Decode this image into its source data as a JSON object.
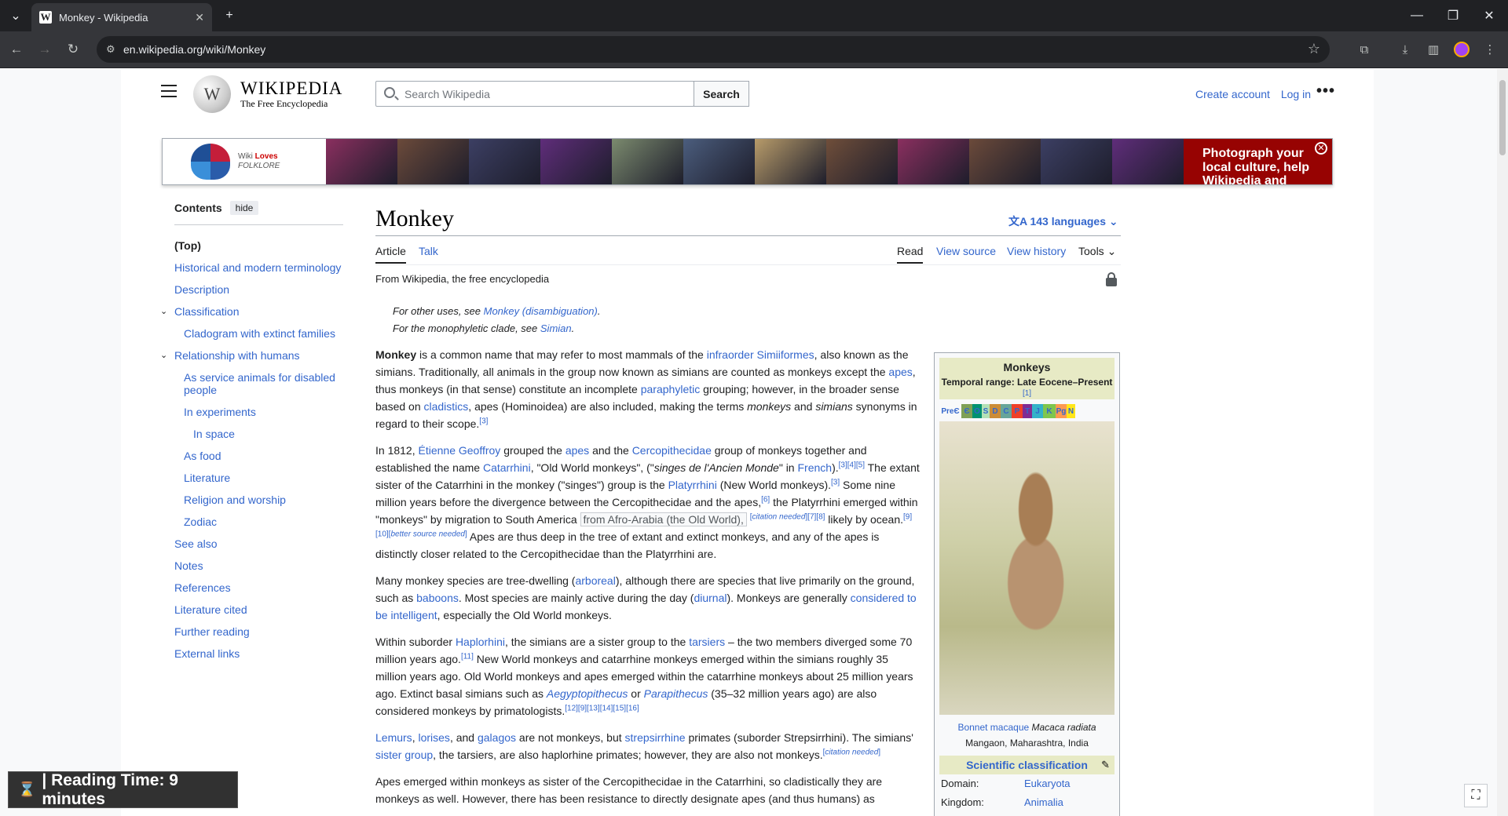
{
  "browser": {
    "tab_title": "Monkey - Wikipedia",
    "tab_favicon": "W",
    "url": "en.wikipedia.org/wiki/Monkey"
  },
  "header": {
    "wordmark": "WIKIPEDIA",
    "tagline": "The Free Encyclopedia",
    "search_placeholder": "Search Wikipedia",
    "search_button": "Search",
    "create_account": "Create account",
    "log_in": "Log in"
  },
  "banner": {
    "logo_line1": "Wiki",
    "logo_line1_b": "Loves",
    "logo_line2": "FOLKLORE",
    "cta": "Photograph your local culture, help Wikipedia and win!",
    "photo_colors": [
      "#8a2f5f",
      "#6b4a3a",
      "#3c3f63",
      "#5f2d7a",
      "#7b8a6e",
      "#4b5d7d",
      "#b79b6a",
      "#6f4e3a",
      "#8a2f5f",
      "#6b4a3a",
      "#3c3f63",
      "#5f2d7a"
    ]
  },
  "toc": {
    "heading": "Contents",
    "hide": "hide",
    "items": [
      {
        "label": "(Top)",
        "level": 1,
        "top": true
      },
      {
        "label": "Historical and modern terminology",
        "level": 1
      },
      {
        "label": "Description",
        "level": 1
      },
      {
        "label": "Classification",
        "level": 1,
        "chevron": true
      },
      {
        "label": "Cladogram with extinct families",
        "level": 2
      },
      {
        "label": "Relationship with humans",
        "level": 1,
        "chevron": true
      },
      {
        "label": "As service animals for disabled people",
        "level": 2,
        "wrap": true
      },
      {
        "label": "In experiments",
        "level": 2
      },
      {
        "label": "In space",
        "level": 3
      },
      {
        "label": "As food",
        "level": 2
      },
      {
        "label": "Literature",
        "level": 2
      },
      {
        "label": "Religion and worship",
        "level": 2
      },
      {
        "label": "Zodiac",
        "level": 2
      },
      {
        "label": "See also",
        "level": 1
      },
      {
        "label": "Notes",
        "level": 1
      },
      {
        "label": "References",
        "level": 1
      },
      {
        "label": "Literature cited",
        "level": 1
      },
      {
        "label": "Further reading",
        "level": 1
      },
      {
        "label": "External links",
        "level": 1
      }
    ]
  },
  "article": {
    "title": "Monkey",
    "languages": "143 languages",
    "tab_article": "Article",
    "tab_talk": "Talk",
    "tab_read": "Read",
    "tab_view_source": "View source",
    "tab_view_history": "View history",
    "tab_tools": "Tools",
    "subtitle": "From Wikipedia, the free encyclopedia",
    "hatnote1_pre": "For other uses, see ",
    "hatnote1_link": "Monkey (disambiguation)",
    "hatnote2_pre": "For the monophyletic clade, see ",
    "hatnote2_link": "Simian"
  },
  "infobox": {
    "name": "Monkeys",
    "range": "Temporal range: Late Eocene–Present",
    "range_ref": "[1]",
    "timeline": [
      {
        "label": "PreЄ",
        "color": "#f8f9fa",
        "w": 28
      },
      {
        "label": "Є",
        "color": "#7fa056",
        "w": 14
      },
      {
        "label": "O",
        "color": "#009270",
        "w": 12
      },
      {
        "label": "S",
        "color": "#b3e1b6",
        "w": 10
      },
      {
        "label": "D",
        "color": "#cb8c37",
        "w": 14
      },
      {
        "label": "C",
        "color": "#67a599",
        "w": 14
      },
      {
        "label": "P",
        "color": "#f04028",
        "w": 14
      },
      {
        "label": "T",
        "color": "#812b92",
        "w": 12
      },
      {
        "label": "J",
        "color": "#34b2c9",
        "w": 14
      },
      {
        "label": "K",
        "color": "#7fc64e",
        "w": 16
      },
      {
        "label": "Pg",
        "color": "#fd9a52",
        "w": 14
      },
      {
        "label": "N",
        "color": "#ffe619",
        "w": 11
      }
    ],
    "caption_link": "Bonnet macaque",
    "caption_species": "Macaca radiata",
    "caption_place": "Mangaon, Maharashtra, India",
    "sci_class": "Scientific classification",
    "domain_label": "Domain:",
    "domain_value": "Eukaryota",
    "kingdom_label": "Kingdom:",
    "kingdom_value": "Animalia"
  },
  "overlay": {
    "reading_time": "| Reading Time: 9 minutes"
  }
}
